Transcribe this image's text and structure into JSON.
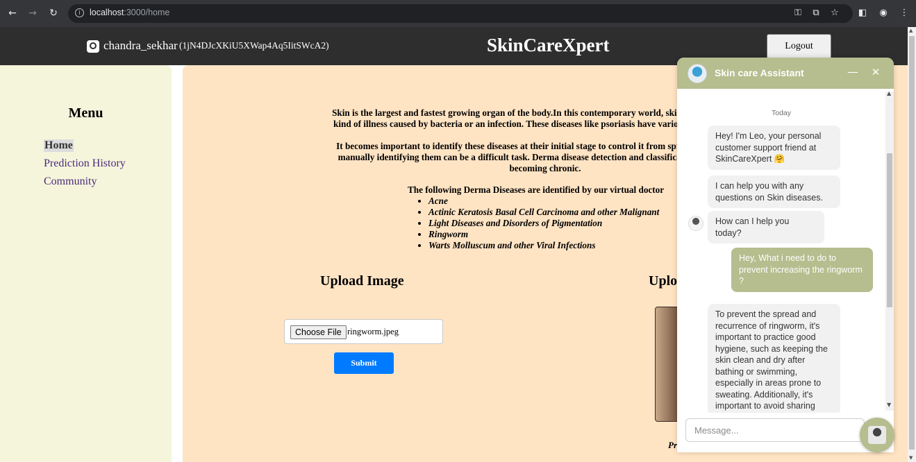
{
  "browser": {
    "url_host": "localhost",
    "url_path": ":3000/home",
    "back_icon": "arrow-left-icon",
    "forward_icon": "arrow-right-icon",
    "reload_icon": "reload-icon"
  },
  "header": {
    "username": "chandra_sekhar",
    "user_id": "(1jN4DJcXKiU5XWap4Aq5IitSWcA2)",
    "brand": "SkinCareXpert",
    "logout_label": "Logout"
  },
  "sidebar": {
    "title": "Menu",
    "items": [
      {
        "label": "Home",
        "active": true
      },
      {
        "label": "Prediction History",
        "active": false
      },
      {
        "label": "Community",
        "active": false
      }
    ]
  },
  "main": {
    "intro_lines": [
      "Skin is the largest and fastest growing organ of the body.In this contemporary world, skin diseases are mostly",
      "kind of illness caused by bacteria or an infection. These diseases like psoriasis have various dangerous effects",
      "It becomes important to identify these diseases at their initial stage to control it from spreading. Since there",
      "manually identifying them can be a difficult task. Derma disease detection and classification can help in ea",
      "becoming chronic."
    ],
    "list_heading": "The following Derma Diseases are identified by our virtual doctor",
    "diseases": [
      "Acne",
      "Actinic Keratosis Basal Cell Carcinoma and other Malignant",
      "Light Diseases and Disorders of Pigmentation",
      "Ringworm",
      "Warts Molluscum and other Viral Infections"
    ],
    "upload_title": "Upload Image",
    "upload_title_right": "Uplo",
    "choose_file_label": "Choose File",
    "file_name": "ringworm.jpeg",
    "submit_label": "Submit",
    "pred_text": "Pr"
  },
  "chat": {
    "title": "Skin care Assistant",
    "day_label": "Today",
    "messages": [
      {
        "from": "bot",
        "text": "Hey! I'm Leo, your personal customer support friend at SkinCareXpert 🤗"
      },
      {
        "from": "bot",
        "text": "I can help you with any questions on Skin diseases."
      },
      {
        "from": "bot",
        "text": "How can I help you today?"
      },
      {
        "from": "user",
        "text": "Hey, What i need to do to prevent increasing the ringworm ?"
      },
      {
        "from": "bot",
        "text": "To prevent the spread and recurrence of ringworm, it's important to practice good hygiene, such as keeping the skin clean and dry after bathing or swimming, especially in areas prone to sweating. Additionally, it's important to avoid sharing"
      }
    ],
    "input_placeholder": "Message..."
  },
  "colors": {
    "header_bg": "#2e2e2e",
    "sidebar_bg": "#f5f5dc",
    "main_bg": "#ffe4c4",
    "accent": "#b6bd8e",
    "submit_bg": "#007bff"
  }
}
